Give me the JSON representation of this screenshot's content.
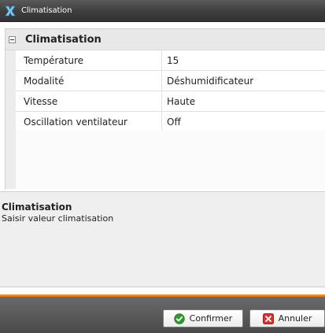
{
  "window": {
    "title": "Climatisation",
    "icon": "x-logo-icon"
  },
  "grid": {
    "section_title": "Climatisation",
    "rows": [
      {
        "label": "Température",
        "value": "15"
      },
      {
        "label": "Modalité",
        "value": "Déshumidificateur"
      },
      {
        "label": "Vitesse",
        "value": "Haute"
      },
      {
        "label": "Oscillation ventilateur",
        "value": "Off"
      }
    ]
  },
  "description": {
    "title": "Climatisation",
    "text": "Saisir valeur climatisation"
  },
  "footer": {
    "confirm_label": "Confirmer",
    "confirm_icon": "check-circle-icon",
    "cancel_label": "Annuler",
    "cancel_icon": "x-box-icon"
  },
  "colors": {
    "titlebar": "#3d3d3d",
    "accent_bar": "#f07d1e",
    "confirm_icon": "#2a9d2a",
    "cancel_icon": "#d9332b"
  }
}
